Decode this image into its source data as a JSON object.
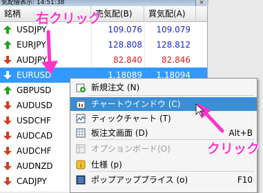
{
  "window": {
    "title": "気配値表示: 14:51:38",
    "close_glyph": "×"
  },
  "header": {
    "symbol": "銘柄",
    "bid": "売気配(B)",
    "ask": "買気配(A)"
  },
  "rows": [
    {
      "symbol": "USDJPY",
      "bid": "109.076",
      "ask": "109.079",
      "dir": "up",
      "color": "blue"
    },
    {
      "symbol": "EURJPY",
      "bid": "128.808",
      "ask": "128.812",
      "dir": "up",
      "color": "blue"
    },
    {
      "symbol": "AUDJPY",
      "bid": "82.840",
      "ask": "82.846",
      "dir": "down",
      "color": "red"
    },
    {
      "symbol": "EURUSD",
      "bid": "1.18089",
      "ask": "1.18094",
      "dir": "down",
      "color": "white"
    },
    {
      "symbol": "GBPUSD",
      "bid": "",
      "ask": "",
      "dir": "up",
      "color": "blue"
    },
    {
      "symbol": "AUDUSD",
      "bid": "",
      "ask": "",
      "dir": "down",
      "color": "red"
    },
    {
      "symbol": "USDCHF",
      "bid": "",
      "ask": "",
      "dir": "down",
      "color": "red"
    },
    {
      "symbol": "AUDCAD",
      "bid": "",
      "ask": "",
      "dir": "down",
      "color": "red"
    },
    {
      "symbol": "AUDCHF",
      "bid": "",
      "ask": "",
      "dir": "down",
      "color": "red"
    },
    {
      "symbol": "AUDNZD",
      "bid": "",
      "ask": "",
      "dir": "down",
      "color": "red"
    },
    {
      "symbol": "CADJPY",
      "bid": "",
      "ask": "",
      "dir": "down",
      "color": "red"
    }
  ],
  "menu": [
    {
      "label": "新規注文 (N)",
      "shortcut": "",
      "icon": "new-order-icon",
      "state": "normal"
    },
    {
      "label": "チャートウインドウ (C)",
      "shortcut": "",
      "icon": "chart-window-icon",
      "state": "highlight"
    },
    {
      "label": "ティックチャート (T)",
      "shortcut": "",
      "icon": "tick-chart-icon",
      "state": "normal"
    },
    {
      "label": "板注文画面 (D)",
      "shortcut": "Alt+B",
      "icon": "depth-order-icon",
      "state": "normal"
    },
    {
      "label": "オプションボード(O)",
      "shortcut": "",
      "icon": "option-board-icon",
      "state": "disabled"
    },
    {
      "label": "仕様 (p)",
      "shortcut": "",
      "icon": "spec-icon",
      "state": "normal"
    },
    {
      "label": "ポップアッププライス (o)",
      "shortcut": "F10",
      "icon": "popup-price-icon",
      "state": "normal"
    }
  ],
  "annotations": {
    "right_click": "右クリック",
    "click": "クリック"
  },
  "colors": {
    "up": "#1fa21f",
    "down": "#d83a1c",
    "bid_blue": "#1a28c8",
    "bid_red": "#d81e1e",
    "selected": "#3399ff",
    "menu_hl": "#3a8ed4",
    "annot": "#ff33cc"
  }
}
